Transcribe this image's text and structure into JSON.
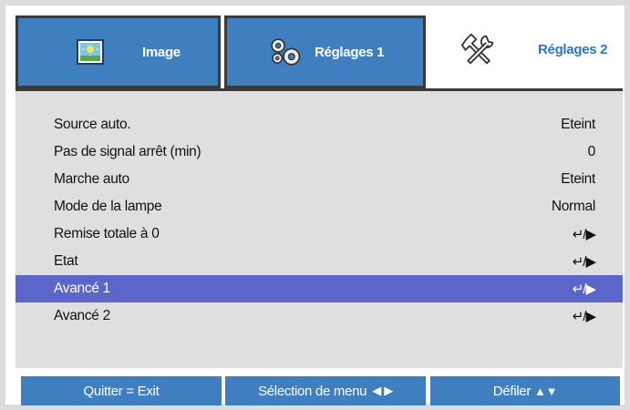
{
  "tabs": [
    {
      "label": "Image",
      "icon": "image-icon"
    },
    {
      "label": "Réglages 1",
      "icon": "gears-icon"
    },
    {
      "label": "Réglages 2",
      "icon": "tools-icon"
    }
  ],
  "menu": {
    "items": [
      {
        "label": "Source auto.",
        "value": "Eteint"
      },
      {
        "label": "Pas de signal arrêt (min)",
        "value": "0"
      },
      {
        "label": "Marche auto",
        "value": "Eteint"
      },
      {
        "label": "Mode de la lampe",
        "value": "Normal"
      },
      {
        "label": "Remise totale à 0",
        "value": "↵/▶"
      },
      {
        "label": "Etat",
        "value": "↵/▶"
      },
      {
        "label": "Avancé 1",
        "value": "↵/▶"
      },
      {
        "label": "Avancé 2",
        "value": "↵/▶"
      }
    ],
    "selected_index": 6
  },
  "footer": {
    "exit": "Quitter = Exit",
    "menu_select": "Sélection de menu",
    "menu_select_arrows": "◀ ▶",
    "scroll": "Défiler",
    "scroll_arrows": "▲▼"
  },
  "colors": {
    "tab_blue": "#3f7fc0",
    "selection": "#5c65c9",
    "active_tab_text": "#2f74c0"
  }
}
